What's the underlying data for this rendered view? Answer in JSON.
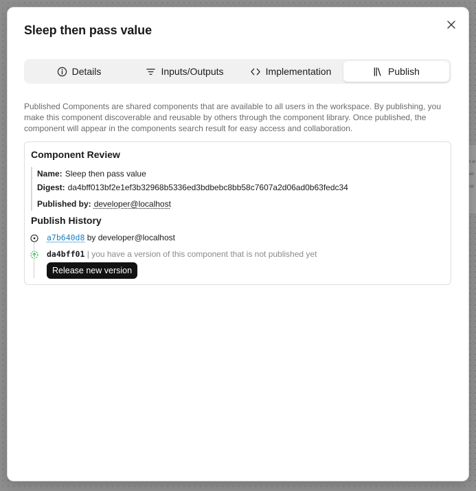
{
  "dialog": {
    "title": "Sleep then pass value",
    "tabs": [
      {
        "label": "Details",
        "icon": "info-circle-icon"
      },
      {
        "label": "Inputs/Outputs",
        "icon": "filter-lines-icon"
      },
      {
        "label": "Implementation",
        "icon": "code-brackets-icon"
      },
      {
        "label": "Publish",
        "icon": "library-books-icon",
        "active": true
      }
    ],
    "description": "Published Components are shared components that are available to all users in the workspace. By publishing, you make this component discoverable and reusable by others through the component library. Once published, the component will appear in the components search result for easy access and collaboration."
  },
  "review": {
    "title": "Component Review",
    "name_label": "Name:",
    "name_value": "Sleep then pass value",
    "digest_label": "Digest:",
    "digest_value": "da4bff013bf2e1ef3b32968b5336ed3bdbebc8bb58c7607a2d06ad0b63fedc34",
    "published_by_label": "Published by:",
    "published_by_value": "developer@localhost"
  },
  "history": {
    "title": "Publish History",
    "entries": [
      {
        "hash": "a7b640d8",
        "text": "by developer@localhost"
      },
      {
        "hash": "da4bff01",
        "separator": "|",
        "text": "you have a version of this component that is not published yet"
      }
    ],
    "release_button": "Release new version"
  },
  "colors": {
    "link": "#1a7fbf",
    "pending": "#2bb24c",
    "button": "#121212"
  }
}
